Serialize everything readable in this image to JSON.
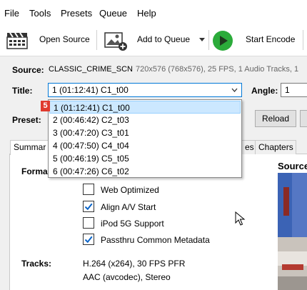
{
  "menu": [
    "File",
    "Tools",
    "Presets",
    "Queue",
    "Help"
  ],
  "toolbar": {
    "open_source": "Open Source",
    "add_to_queue": "Add to Queue",
    "start_encode": "Start Encode"
  },
  "source": {
    "label": "Source:",
    "name": "CLASSIC_CRIME_SCN",
    "info": "720x576 (768x576), 25 FPS, 1 Audio Tracks, 1"
  },
  "title": {
    "label": "Title:",
    "selected": "1  (01:12:41) C1_t00",
    "options": [
      "1  (01:12:41) C1_t00",
      "2  (00:46:42) C2_t03",
      "3  (00:47:20) C3_t01",
      "4  (00:47:50) C4_t04",
      "5  (00:46:19) C5_t05",
      "6  (00:47:26) C6_t02"
    ],
    "annotation_number": "5"
  },
  "angle": {
    "label": "Angle:",
    "value": "1"
  },
  "preset": {
    "label": "Preset:",
    "reload": "Reload"
  },
  "tabs": {
    "summary": "Summar",
    "subtitles_partial": "es",
    "chapters": "Chapters"
  },
  "summary": {
    "format_label": "Forma",
    "options": [
      {
        "label": "Web Optimized",
        "checked": false
      },
      {
        "label": "Align A/V Start",
        "checked": true
      },
      {
        "label": "iPod 5G Support",
        "checked": false
      },
      {
        "label": "Passthru Common Metadata",
        "checked": true
      }
    ],
    "tracks_label": "Tracks:",
    "tracks": [
      "H.264 (x264), 30 FPS PFR",
      "AAC (avcodec), Stereo"
    ]
  },
  "preview": {
    "label": "Source"
  },
  "colors": {
    "accent": "#0a64c8",
    "play": "#2bab3a",
    "annotation": "#e03a2e"
  }
}
